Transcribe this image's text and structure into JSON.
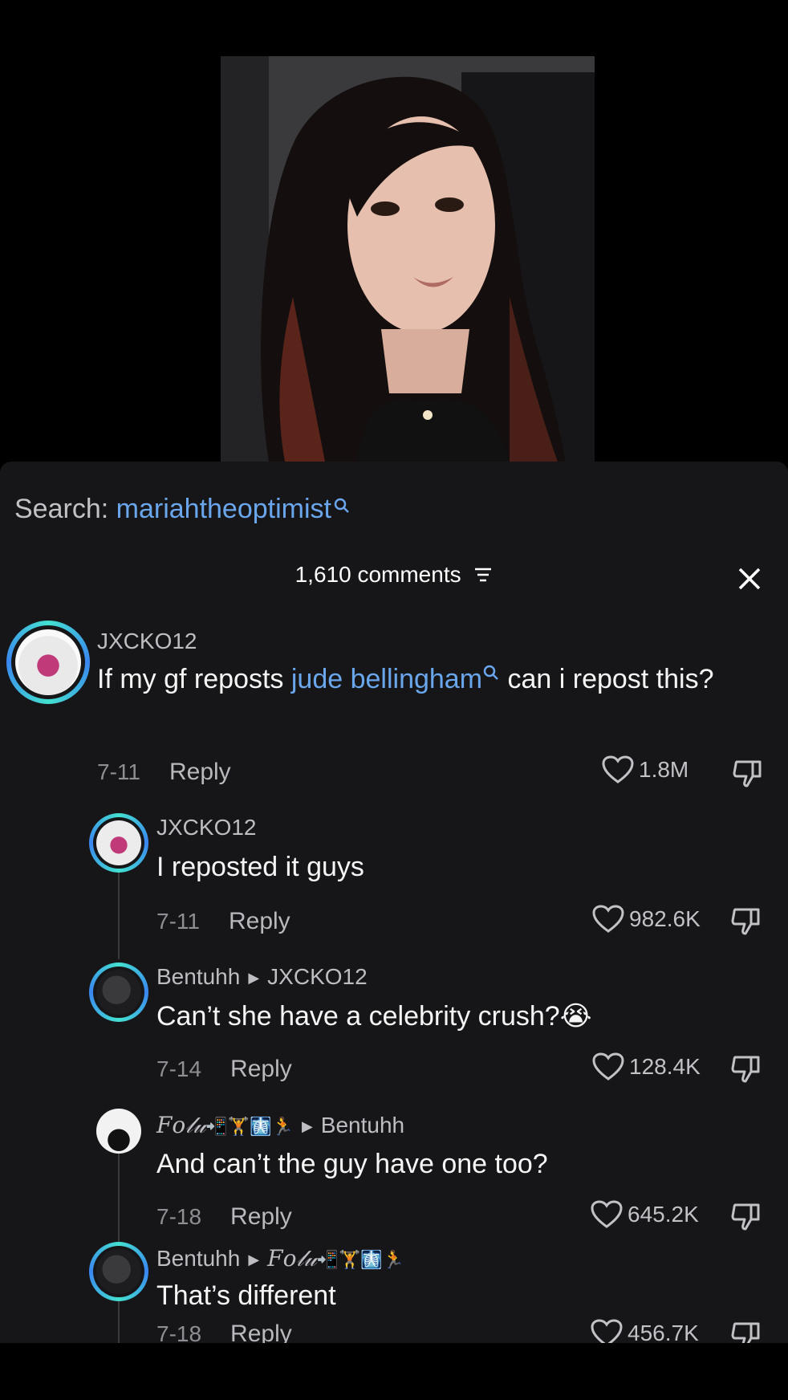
{
  "search": {
    "prefix": "Search:",
    "term": "mariahtheoptimist"
  },
  "header": {
    "count": "1,610 comments"
  },
  "comments": [
    {
      "username": "JXCKO12",
      "text_before": "If my gf reposts ",
      "link": "jude bellingham",
      "text_after": " can i repost this?",
      "date": "7-11",
      "reply": "Reply",
      "likes": "1.8M"
    },
    {
      "username": "JXCKO12",
      "text": "I reposted it guys",
      "date": "7-11",
      "reply": "Reply",
      "likes": "982.6K"
    },
    {
      "username": "Bentuhh",
      "reply_to": "JXCKO12",
      "text": "Can’t she have a celebrity crush?😭",
      "date": "7-14",
      "reply": "Reply",
      "likes": "128.4K"
    },
    {
      "username": "𝐹𝑜𝓁𝓊",
      "reply_to": "Bentuhh",
      "text": "And can’t the guy have one too?",
      "date": "7-18",
      "reply": "Reply",
      "likes": "645.2K"
    },
    {
      "username": "Bentuhh",
      "reply_to": "𝐹𝑜𝓁𝓊",
      "text": "That’s different",
      "date": "7-18",
      "reply": "Reply",
      "likes": "456.7K"
    }
  ],
  "icons": [
    "search-icon",
    "sort-icon",
    "close-icon",
    "heart-icon",
    "dislike-icon"
  ],
  "colors": {
    "link": "#6aa6ec",
    "sheet": "#161618",
    "ring_a": "#43e0d0",
    "ring_b": "#3a86f0"
  }
}
